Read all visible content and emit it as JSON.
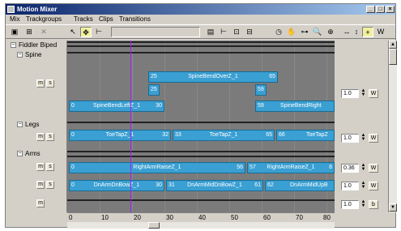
{
  "window": {
    "title": "Motion Mixer",
    "min": "_",
    "max": "□",
    "close": "×"
  },
  "menu": [
    "Mix",
    "Trackgroups",
    "Tracks",
    "Clips",
    "Transitions"
  ],
  "toolbar": {
    "left_icons": [
      "▣",
      "⊞",
      "✕",
      "↖",
      "✥",
      "⊢"
    ],
    "right_icons": [
      "▤",
      "⊢",
      "⊡",
      "⊟",
      "◷",
      "✋",
      "⊶",
      "🔍",
      "⊕",
      "↔",
      "↕",
      "+",
      "W"
    ]
  },
  "tree": {
    "root": "Fiddler Biped",
    "groups": [
      {
        "label": "Spine",
        "m": "m",
        "s": "s"
      },
      {
        "label": "Legs",
        "m": "m",
        "s": "s"
      },
      {
        "label": "Arms",
        "m": "m",
        "s": "s",
        "m2": "m",
        "s2": "s"
      }
    ],
    "bottom": {
      "m": "m"
    }
  },
  "clips": {
    "spine_top": {
      "start": "25",
      "name": "SpineBendOverZ_1",
      "end": "65"
    },
    "spine_mid_a": {
      "start": "25"
    },
    "spine_mid_b": {
      "start": "59"
    },
    "spine_bottom_a": {
      "start": "0",
      "name": "SpineBendLeftZ_1",
      "end": "30"
    },
    "spine_bottom_b": {
      "start": "59",
      "name": "SpineBendRight"
    },
    "legs_a": {
      "start": "0",
      "name": "ToeTapZ_1",
      "end": "32"
    },
    "legs_b": {
      "start": "33",
      "name": "ToeTapZ_1",
      "end": "65"
    },
    "legs_c": {
      "start": "66",
      "name": "ToeTapZ"
    },
    "arms_a": {
      "start": "0",
      "name": "RightArmRaiseZ_1",
      "end": "56"
    },
    "arms_b": {
      "start": "57",
      "name": "RightArmRaiseZ_1",
      "end": "8"
    },
    "arms2_a": {
      "start": "0",
      "name": "DnArmDnBowZ_1",
      "end": "30"
    },
    "arms2_b": {
      "start": "31",
      "name": "DnArmMidDnBowZ_1",
      "end": "61"
    },
    "arms2_c": {
      "start": "62",
      "name": "DnArmMidUpB"
    }
  },
  "weights": [
    {
      "value": "1.0",
      "btn": "W"
    },
    {
      "value": "1.0",
      "btn": "W"
    },
    {
      "value": "0.36",
      "btn": "W"
    },
    {
      "value": "1.0",
      "btn": "W"
    },
    {
      "value": "1.0",
      "btn": "b"
    }
  ],
  "ruler": [
    "0",
    "10",
    "20",
    "30",
    "40",
    "50",
    "60",
    "70",
    "80"
  ]
}
